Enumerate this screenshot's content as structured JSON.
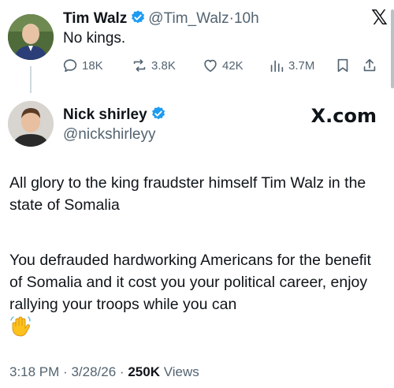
{
  "quoted_tweet": {
    "author_name": "Tim Walz",
    "author_handle": "@Tim_Walz",
    "separator": "·",
    "time_ago": "10h",
    "text": "No kings.",
    "replies": "18K",
    "reposts": "3.8K",
    "likes": "42K",
    "views": "3.7M",
    "icons": [
      "reply-icon",
      "repost-icon",
      "like-icon",
      "views-icon",
      "bookmark-icon",
      "share-icon",
      "x-logo",
      "verified-badge-icon"
    ]
  },
  "main_tweet": {
    "author_name": "Nick shirley",
    "author_handle": "@nickshirleyy",
    "brand": "X.com",
    "paragraph_1": "All glory to the king fraudster himself Tim Walz in the state of Somalia",
    "paragraph_2": "You defrauded hardworking Americans for the benefit of Somalia and it cost you your political career, enjoy rallying your troops while you can",
    "emoji": "waving-hand-emoji",
    "timestamp_time": "3:18 PM",
    "timestamp_date": "3/28/26",
    "view_count": "250K",
    "view_label": "Views",
    "separator": "·"
  },
  "colors": {
    "text_primary": "#0f1419",
    "text_secondary": "#536471",
    "verified_blue": "#1d9bf0",
    "background": "#ffffff"
  }
}
